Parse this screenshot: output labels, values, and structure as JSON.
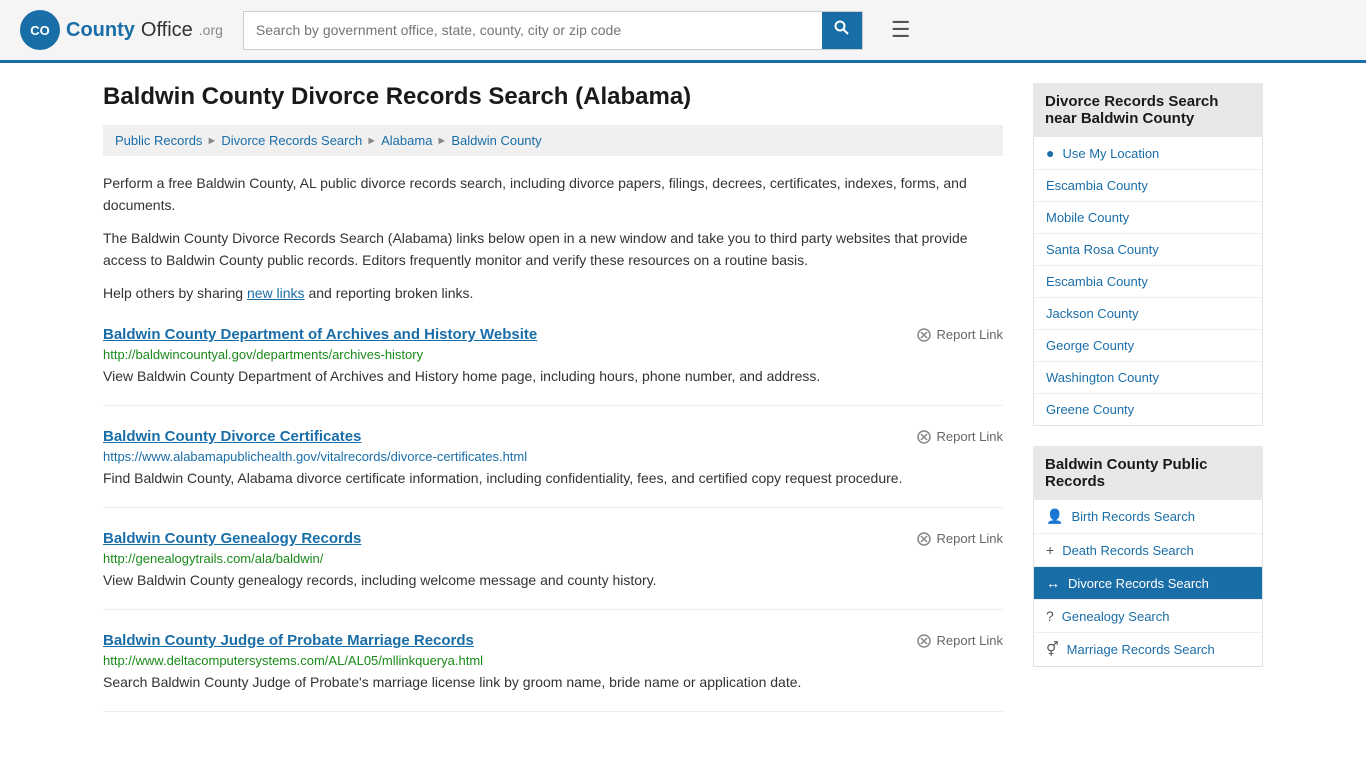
{
  "header": {
    "logo_text": "County",
    "logo_org": "Office",
    "logo_org_domain": ".org",
    "search_placeholder": "Search by government office, state, county, city or zip code",
    "search_value": ""
  },
  "page": {
    "title": "Baldwin County Divorce Records Search (Alabama)",
    "breadcrumbs": [
      {
        "label": "Public Records",
        "href": "#"
      },
      {
        "label": "Divorce Records Search",
        "href": "#"
      },
      {
        "label": "Alabama",
        "href": "#"
      },
      {
        "label": "Baldwin County",
        "href": "#"
      }
    ],
    "description1": "Perform a free Baldwin County, AL public divorce records search, including divorce papers, filings, decrees, certificates, indexes, forms, and documents.",
    "description2": "The Baldwin County Divorce Records Search (Alabama) links below open in a new window and take you to third party websites that provide access to Baldwin County public records. Editors frequently monitor and verify these resources on a routine basis.",
    "description3_pre": "Help others by sharing ",
    "description3_link": "new links",
    "description3_post": " and reporting broken links."
  },
  "records": [
    {
      "title": "Baldwin County Department of Archives and History Website",
      "url": "http://baldwincountyal.gov/departments/archives-history",
      "url_color": "green",
      "description": "View Baldwin County Department of Archives and History home page, including hours, phone number, and address.",
      "report_label": "Report Link"
    },
    {
      "title": "Baldwin County Divorce Certificates",
      "url": "https://www.alabamapublichealth.gov/vitalrecords/divorce-certificates.html",
      "url_color": "blue",
      "description": "Find Baldwin County, Alabama divorce certificate information, including confidentiality, fees, and certified copy request procedure.",
      "report_label": "Report Link"
    },
    {
      "title": "Baldwin County Genealogy Records",
      "url": "http://genealogytrails.com/ala/baldwin/",
      "url_color": "green",
      "description": "View Baldwin County genealogy records, including welcome message and county history.",
      "report_label": "Report Link"
    },
    {
      "title": "Baldwin County Judge of Probate Marriage Records",
      "url": "http://www.deltacomputersystems.com/AL/AL05/mllinkquerya.html",
      "url_color": "green",
      "description": "Search Baldwin County Judge of Probate's marriage license link by groom name, bride name or application date.",
      "report_label": "Report Link"
    }
  ],
  "sidebar": {
    "nearby_section_title": "Divorce Records Search near Baldwin County",
    "nearby_items": [
      {
        "label": "Use My Location",
        "icon": "location",
        "href": "#"
      },
      {
        "label": "Escambia County",
        "href": "#"
      },
      {
        "label": "Mobile County",
        "href": "#"
      },
      {
        "label": "Santa Rosa County",
        "href": "#"
      },
      {
        "label": "Escambia County",
        "href": "#"
      },
      {
        "label": "Jackson County",
        "href": "#"
      },
      {
        "label": "George County",
        "href": "#"
      },
      {
        "label": "Washington County",
        "href": "#"
      },
      {
        "label": "Greene County",
        "href": "#"
      }
    ],
    "public_records_section_title": "Baldwin County Public Records",
    "public_records_items": [
      {
        "label": "Birth Records Search",
        "icon": "person",
        "href": "#",
        "active": false
      },
      {
        "label": "Death Records Search",
        "icon": "plus",
        "href": "#",
        "active": false
      },
      {
        "label": "Divorce Records Search",
        "icon": "arrows",
        "href": "#",
        "active": true
      },
      {
        "label": "Genealogy Search",
        "icon": "question",
        "href": "#",
        "active": false
      },
      {
        "label": "Marriage Records Search",
        "icon": "gender",
        "href": "#",
        "active": false
      }
    ]
  }
}
